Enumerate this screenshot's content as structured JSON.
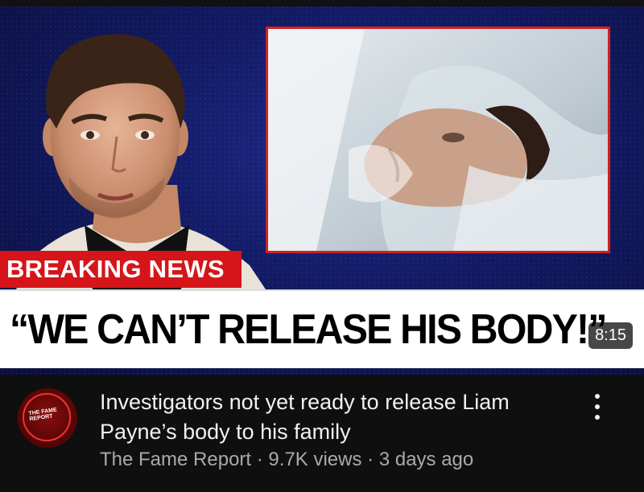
{
  "thumbnail": {
    "breaking_label": "BREAKING NEWS",
    "headline": "“WE CAN’T RELEASE HIS BODY!”",
    "duration": "8:15",
    "accent_red": "#d5151a",
    "bg_blue": "#121a63"
  },
  "channel": {
    "name": "The Fame Report",
    "avatar_text_line1": "THE FAME",
    "avatar_text_line2": "REPORT"
  },
  "video": {
    "title": "Investigators not yet ready to release Liam Payne’s body to his family",
    "views": "9.7K views",
    "age": "3 days ago",
    "separator": "·"
  },
  "icons": {
    "menu": "more-vert-icon"
  }
}
